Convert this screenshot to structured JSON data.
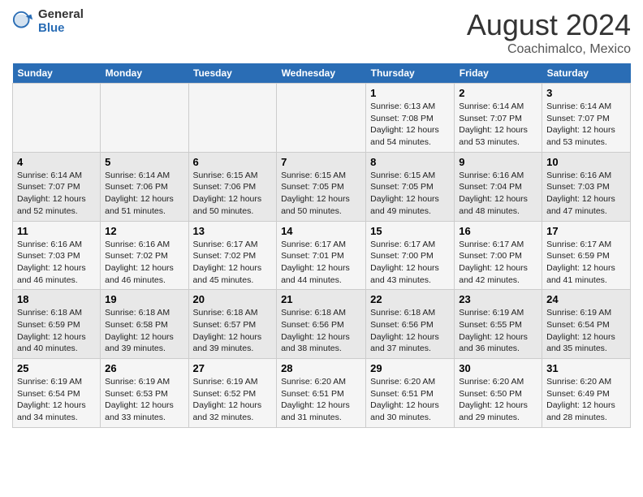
{
  "header": {
    "logo_general": "General",
    "logo_blue": "Blue",
    "month_title": "August 2024",
    "location": "Coachimalco, Mexico"
  },
  "days_of_week": [
    "Sunday",
    "Monday",
    "Tuesday",
    "Wednesday",
    "Thursday",
    "Friday",
    "Saturday"
  ],
  "weeks": [
    [
      {
        "day": "",
        "info": ""
      },
      {
        "day": "",
        "info": ""
      },
      {
        "day": "",
        "info": ""
      },
      {
        "day": "",
        "info": ""
      },
      {
        "day": "1",
        "info": "Sunrise: 6:13 AM\nSunset: 7:08 PM\nDaylight: 12 hours\nand 54 minutes."
      },
      {
        "day": "2",
        "info": "Sunrise: 6:14 AM\nSunset: 7:07 PM\nDaylight: 12 hours\nand 53 minutes."
      },
      {
        "day": "3",
        "info": "Sunrise: 6:14 AM\nSunset: 7:07 PM\nDaylight: 12 hours\nand 53 minutes."
      }
    ],
    [
      {
        "day": "4",
        "info": "Sunrise: 6:14 AM\nSunset: 7:07 PM\nDaylight: 12 hours\nand 52 minutes."
      },
      {
        "day": "5",
        "info": "Sunrise: 6:14 AM\nSunset: 7:06 PM\nDaylight: 12 hours\nand 51 minutes."
      },
      {
        "day": "6",
        "info": "Sunrise: 6:15 AM\nSunset: 7:06 PM\nDaylight: 12 hours\nand 50 minutes."
      },
      {
        "day": "7",
        "info": "Sunrise: 6:15 AM\nSunset: 7:05 PM\nDaylight: 12 hours\nand 50 minutes."
      },
      {
        "day": "8",
        "info": "Sunrise: 6:15 AM\nSunset: 7:05 PM\nDaylight: 12 hours\nand 49 minutes."
      },
      {
        "day": "9",
        "info": "Sunrise: 6:16 AM\nSunset: 7:04 PM\nDaylight: 12 hours\nand 48 minutes."
      },
      {
        "day": "10",
        "info": "Sunrise: 6:16 AM\nSunset: 7:03 PM\nDaylight: 12 hours\nand 47 minutes."
      }
    ],
    [
      {
        "day": "11",
        "info": "Sunrise: 6:16 AM\nSunset: 7:03 PM\nDaylight: 12 hours\nand 46 minutes."
      },
      {
        "day": "12",
        "info": "Sunrise: 6:16 AM\nSunset: 7:02 PM\nDaylight: 12 hours\nand 46 minutes."
      },
      {
        "day": "13",
        "info": "Sunrise: 6:17 AM\nSunset: 7:02 PM\nDaylight: 12 hours\nand 45 minutes."
      },
      {
        "day": "14",
        "info": "Sunrise: 6:17 AM\nSunset: 7:01 PM\nDaylight: 12 hours\nand 44 minutes."
      },
      {
        "day": "15",
        "info": "Sunrise: 6:17 AM\nSunset: 7:00 PM\nDaylight: 12 hours\nand 43 minutes."
      },
      {
        "day": "16",
        "info": "Sunrise: 6:17 AM\nSunset: 7:00 PM\nDaylight: 12 hours\nand 42 minutes."
      },
      {
        "day": "17",
        "info": "Sunrise: 6:17 AM\nSunset: 6:59 PM\nDaylight: 12 hours\nand 41 minutes."
      }
    ],
    [
      {
        "day": "18",
        "info": "Sunrise: 6:18 AM\nSunset: 6:59 PM\nDaylight: 12 hours\nand 40 minutes."
      },
      {
        "day": "19",
        "info": "Sunrise: 6:18 AM\nSunset: 6:58 PM\nDaylight: 12 hours\nand 39 minutes."
      },
      {
        "day": "20",
        "info": "Sunrise: 6:18 AM\nSunset: 6:57 PM\nDaylight: 12 hours\nand 39 minutes."
      },
      {
        "day": "21",
        "info": "Sunrise: 6:18 AM\nSunset: 6:56 PM\nDaylight: 12 hours\nand 38 minutes."
      },
      {
        "day": "22",
        "info": "Sunrise: 6:18 AM\nSunset: 6:56 PM\nDaylight: 12 hours\nand 37 minutes."
      },
      {
        "day": "23",
        "info": "Sunrise: 6:19 AM\nSunset: 6:55 PM\nDaylight: 12 hours\nand 36 minutes."
      },
      {
        "day": "24",
        "info": "Sunrise: 6:19 AM\nSunset: 6:54 PM\nDaylight: 12 hours\nand 35 minutes."
      }
    ],
    [
      {
        "day": "25",
        "info": "Sunrise: 6:19 AM\nSunset: 6:54 PM\nDaylight: 12 hours\nand 34 minutes."
      },
      {
        "day": "26",
        "info": "Sunrise: 6:19 AM\nSunset: 6:53 PM\nDaylight: 12 hours\nand 33 minutes."
      },
      {
        "day": "27",
        "info": "Sunrise: 6:19 AM\nSunset: 6:52 PM\nDaylight: 12 hours\nand 32 minutes."
      },
      {
        "day": "28",
        "info": "Sunrise: 6:20 AM\nSunset: 6:51 PM\nDaylight: 12 hours\nand 31 minutes."
      },
      {
        "day": "29",
        "info": "Sunrise: 6:20 AM\nSunset: 6:51 PM\nDaylight: 12 hours\nand 30 minutes."
      },
      {
        "day": "30",
        "info": "Sunrise: 6:20 AM\nSunset: 6:50 PM\nDaylight: 12 hours\nand 29 minutes."
      },
      {
        "day": "31",
        "info": "Sunrise: 6:20 AM\nSunset: 6:49 PM\nDaylight: 12 hours\nand 28 minutes."
      }
    ]
  ]
}
